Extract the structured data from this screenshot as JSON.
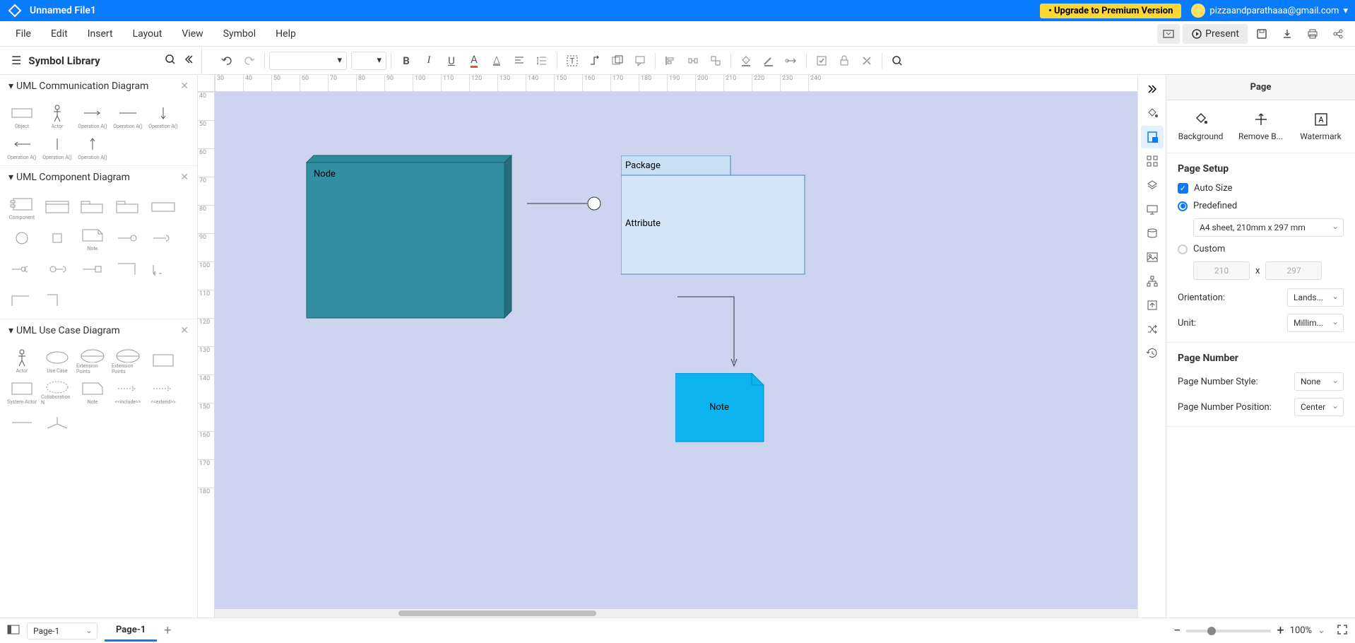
{
  "titlebar": {
    "filename": "Unnamed File1",
    "upgrade": "• Upgrade to Premium Version",
    "email": "pizzaandparathaaa@gmail.com"
  },
  "menu": {
    "items": [
      "File",
      "Edit",
      "Insert",
      "Layout",
      "View",
      "Symbol",
      "Help"
    ],
    "present": "Present"
  },
  "symbol_library": {
    "title": "Symbol Library",
    "categories": [
      {
        "title": "UML Communication Diagram"
      },
      {
        "title": "UML Component Diagram"
      },
      {
        "title": "UML Use Case Diagram"
      }
    ],
    "shape_labels": {
      "object": "Object",
      "actor": "Actor",
      "opA": "Operation A()",
      "component": "Component",
      "note": "Note",
      "usecase": "Use Case",
      "extpoints": "Extension Points",
      "system": "System Actor",
      "collab": "Collaboration N",
      "include": "<<include>>",
      "extend": "<<extend>>"
    }
  },
  "ruler_h": [
    "30",
    "40",
    "50",
    "60",
    "70",
    "80",
    "90",
    "100",
    "110",
    "120",
    "130",
    "140",
    "150",
    "160",
    "170",
    "180",
    "190",
    "200",
    "210",
    "220",
    "230",
    "240"
  ],
  "ruler_v": [
    "40",
    "50",
    "60",
    "70",
    "80",
    "90",
    "100",
    "110",
    "120",
    "130",
    "140",
    "150",
    "160",
    "170",
    "180"
  ],
  "diagram": {
    "node": "Node",
    "package": "Package",
    "attribute": "Attribute",
    "note": "Note"
  },
  "right": {
    "title": "Page",
    "tools": [
      "Background",
      "Remove B...",
      "Watermark"
    ],
    "page_setup": {
      "title": "Page Setup",
      "auto_size": "Auto Size",
      "predefined": "Predefined",
      "paper": "A4 sheet, 210mm x 297 mm",
      "custom": "Custom",
      "w": "210",
      "h": "297",
      "x": "x",
      "orientation_label": "Orientation:",
      "orientation": "Lands...",
      "unit_label": "Unit:",
      "unit": "Millim..."
    },
    "page_number": {
      "title": "Page Number",
      "style_label": "Page Number Style:",
      "style": "None",
      "pos_label": "Page Number Position:",
      "pos": "Center"
    }
  },
  "bottom": {
    "page_select": "Page-1",
    "tab": "Page-1",
    "zoom": "100%"
  }
}
